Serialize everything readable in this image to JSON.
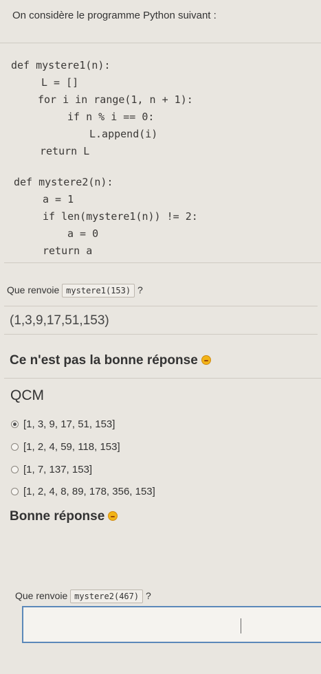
{
  "intro": "On considère le programme Python suivant :",
  "code": {
    "lines": [
      "def mystere1(n):",
      "L = []",
      "for i in range(1, n + 1):",
      "if n % i == 0:",
      "L.append(i)",
      "return L",
      "def mystere2(n):",
      "a = 1",
      "if len(mystere1(n)) != 2:",
      "a = 0",
      "return a"
    ]
  },
  "question1": {
    "prefix": "Que renvoie",
    "chip": "mystere1(153)",
    "suffix": "?"
  },
  "answer1_value": "(1,3,9,17,51,153)",
  "feedback_wrong": "Ce n'est pas la bonne réponse",
  "qcm": {
    "title": "QCM",
    "options": [
      {
        "label": "[1, 3, 9, 17, 51, 153]",
        "selected": true
      },
      {
        "label": "[1, 2, 4, 59, 118, 153]",
        "selected": false
      },
      {
        "label": "[1, 7, 137, 153]",
        "selected": false
      },
      {
        "label": "[1, 2, 4, 8, 89, 178, 356, 153]",
        "selected": false
      }
    ]
  },
  "feedback_good": "Bonne réponse",
  "question2": {
    "prefix": "Que renvoie",
    "chip": "mystere2(467)",
    "suffix": "?"
  },
  "answer2_value": ""
}
